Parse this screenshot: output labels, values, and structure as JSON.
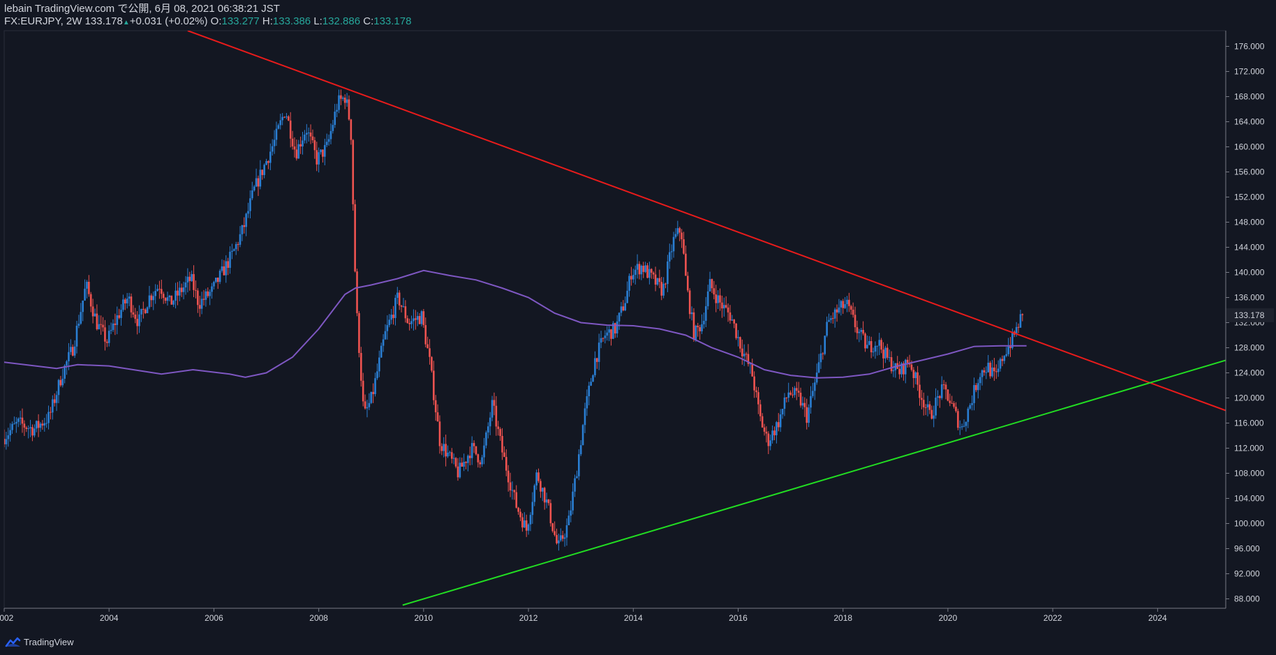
{
  "header": {
    "line1": "lebain TradingView.com で公開, 6月 08, 2021 06:38:21 JST",
    "symbol": "FX:EURJPY, 2W",
    "last": "133.178",
    "change_arrow": "▲",
    "change": "+0.031 (+0.02%)",
    "o_label": "O:",
    "o_value": "133.277",
    "h_label": "H:",
    "h_value": "133.386",
    "l_label": "L:",
    "l_value": "132.886",
    "c_label": "C:",
    "c_value": "133.178"
  },
  "footer": {
    "brand": "TradingView",
    "icon": "tradingview-logo-icon"
  },
  "colors": {
    "background": "#131722",
    "bull": "#2a7fd4",
    "bear": "#ef5350",
    "moving_average": "#7e57c2",
    "resistance": "#e81b1b",
    "support": "#22dd22",
    "axis_text": "#d1d4dc",
    "price_label_bg": "#1e222d"
  },
  "chart_data": {
    "type": "candlestick",
    "symbol": "FX:EURJPY",
    "interval": "2W",
    "x_tick_labels": [
      "2002",
      "2004",
      "2006",
      "2008",
      "2010",
      "2012",
      "2014",
      "2016",
      "2018",
      "2020",
      "2022",
      "2024"
    ],
    "xlim": [
      2002.0,
      2025.3
    ],
    "y_tick_labels": [
      "88.000",
      "92.000",
      "96.000",
      "100.000",
      "104.000",
      "108.000",
      "112.000",
      "116.000",
      "120.000",
      "124.000",
      "128.000",
      "132.000",
      "136.000",
      "140.000",
      "144.000",
      "148.000",
      "152.000",
      "156.000",
      "160.000",
      "164.000",
      "168.000",
      "172.000",
      "176.000"
    ],
    "ylim": [
      86.5,
      178.5
    ],
    "last_price_label": "133.178",
    "price_path": [
      [
        2002.0,
        113.5
      ],
      [
        2002.3,
        116
      ],
      [
        2002.6,
        115
      ],
      [
        2002.9,
        117
      ],
      [
        2003.15,
        124
      ],
      [
        2003.35,
        128
      ],
      [
        2003.6,
        138
      ],
      [
        2003.8,
        132
      ],
      [
        2004.0,
        129
      ],
      [
        2004.2,
        133
      ],
      [
        2004.4,
        136
      ],
      [
        2004.6,
        132
      ],
      [
        2004.8,
        136
      ],
      [
        2005.0,
        138
      ],
      [
        2005.2,
        135
      ],
      [
        2005.4,
        137
      ],
      [
        2005.6,
        139
      ],
      [
        2005.75,
        135
      ],
      [
        2006.0,
        137
      ],
      [
        2006.2,
        140
      ],
      [
        2006.4,
        143
      ],
      [
        2006.6,
        147
      ],
      [
        2006.8,
        153
      ],
      [
        2007.0,
        157
      ],
      [
        2007.2,
        161
      ],
      [
        2007.4,
        166
      ],
      [
        2007.6,
        159
      ],
      [
        2007.8,
        163
      ],
      [
        2008.0,
        158
      ],
      [
        2008.2,
        160
      ],
      [
        2008.4,
        167
      ],
      [
        2008.55,
        168
      ],
      [
        2008.65,
        163
      ],
      [
        2008.75,
        135
      ],
      [
        2008.9,
        117
      ],
      [
        2009.05,
        120
      ],
      [
        2009.3,
        130
      ],
      [
        2009.55,
        136
      ],
      [
        2009.75,
        132
      ],
      [
        2010.0,
        133
      ],
      [
        2010.15,
        126
      ],
      [
        2010.35,
        113
      ],
      [
        2010.5,
        111
      ],
      [
        2010.7,
        108
      ],
      [
        2010.95,
        112
      ],
      [
        2011.15,
        110
      ],
      [
        2011.35,
        119
      ],
      [
        2011.55,
        111
      ],
      [
        2011.8,
        103
      ],
      [
        2012.0,
        99
      ],
      [
        2012.2,
        108
      ],
      [
        2012.4,
        103
      ],
      [
        2012.6,
        96
      ],
      [
        2012.8,
        100
      ],
      [
        2012.95,
        108
      ],
      [
        2013.1,
        117
      ],
      [
        2013.3,
        126
      ],
      [
        2013.5,
        130
      ],
      [
        2013.7,
        131
      ],
      [
        2013.9,
        136
      ],
      [
        2014.0,
        140
      ],
      [
        2014.2,
        141
      ],
      [
        2014.4,
        139
      ],
      [
        2014.6,
        137
      ],
      [
        2014.8,
        145
      ],
      [
        2014.95,
        147
      ],
      [
        2015.05,
        138
      ],
      [
        2015.2,
        130
      ],
      [
        2015.35,
        132
      ],
      [
        2015.5,
        138
      ],
      [
        2015.7,
        135
      ],
      [
        2015.9,
        133
      ],
      [
        2016.1,
        128
      ],
      [
        2016.3,
        124
      ],
      [
        2016.45,
        117
      ],
      [
        2016.6,
        113
      ],
      [
        2016.8,
        116
      ],
      [
        2017.0,
        121
      ],
      [
        2017.2,
        120
      ],
      [
        2017.35,
        117
      ],
      [
        2017.55,
        124
      ],
      [
        2017.75,
        132
      ],
      [
        2017.95,
        134
      ],
      [
        2018.1,
        135
      ],
      [
        2018.3,
        131
      ],
      [
        2018.5,
        128
      ],
      [
        2018.7,
        129
      ],
      [
        2018.9,
        126
      ],
      [
        2019.1,
        124
      ],
      [
        2019.3,
        126
      ],
      [
        2019.5,
        121
      ],
      [
        2019.7,
        117
      ],
      [
        2019.9,
        121
      ],
      [
        2020.0,
        121
      ],
      [
        2020.15,
        118
      ],
      [
        2020.3,
        115
      ],
      [
        2020.5,
        120
      ],
      [
        2020.65,
        124
      ],
      [
        2020.8,
        125
      ],
      [
        2020.95,
        123
      ],
      [
        2021.1,
        127
      ],
      [
        2021.25,
        129
      ],
      [
        2021.35,
        131
      ],
      [
        2021.45,
        133.2
      ]
    ],
    "moving_average": [
      [
        2002.0,
        125.7
      ],
      [
        2003.0,
        124.7
      ],
      [
        2003.4,
        125.3
      ],
      [
        2004.0,
        125.1
      ],
      [
        2005.0,
        123.8
      ],
      [
        2005.6,
        124.5
      ],
      [
        2006.3,
        123.8
      ],
      [
        2006.6,
        123.3
      ],
      [
        2007.0,
        124.0
      ],
      [
        2007.5,
        126.5
      ],
      [
        2008.0,
        131.0
      ],
      [
        2008.5,
        136.5
      ],
      [
        2008.7,
        137.5
      ],
      [
        2009.0,
        138.0
      ],
      [
        2009.5,
        139.0
      ],
      [
        2010.0,
        140.3
      ],
      [
        2010.5,
        139.5
      ],
      [
        2011.0,
        138.8
      ],
      [
        2011.5,
        137.5
      ],
      [
        2012.0,
        136.0
      ],
      [
        2012.5,
        133.5
      ],
      [
        2013.0,
        132.0
      ],
      [
        2013.5,
        131.6
      ],
      [
        2014.0,
        131.5
      ],
      [
        2014.5,
        131.0
      ],
      [
        2015.0,
        130.0
      ],
      [
        2015.5,
        128.0
      ],
      [
        2016.0,
        126.5
      ],
      [
        2016.5,
        124.5
      ],
      [
        2017.0,
        123.6
      ],
      [
        2017.5,
        123.2
      ],
      [
        2018.0,
        123.3
      ],
      [
        2018.5,
        123.8
      ],
      [
        2019.0,
        125.0
      ],
      [
        2019.5,
        126.0
      ],
      [
        2020.0,
        127.0
      ],
      [
        2020.5,
        128.2
      ],
      [
        2021.0,
        128.3
      ],
      [
        2021.5,
        128.3
      ]
    ],
    "trend_lines": [
      {
        "name": "resistance",
        "points": [
          [
            2005.5,
            178.5
          ],
          [
            2008.55,
            169.9
          ],
          [
            2014.95,
            150.1
          ],
          [
            2021.25,
            130.3
          ],
          [
            2025.3,
            118.0
          ]
        ]
      },
      {
        "name": "support",
        "points": [
          [
            2009.6,
            87.0
          ],
          [
            2012.7,
            94.3
          ],
          [
            2020.3,
            114.6
          ],
          [
            2025.3,
            126.0
          ]
        ]
      }
    ]
  }
}
